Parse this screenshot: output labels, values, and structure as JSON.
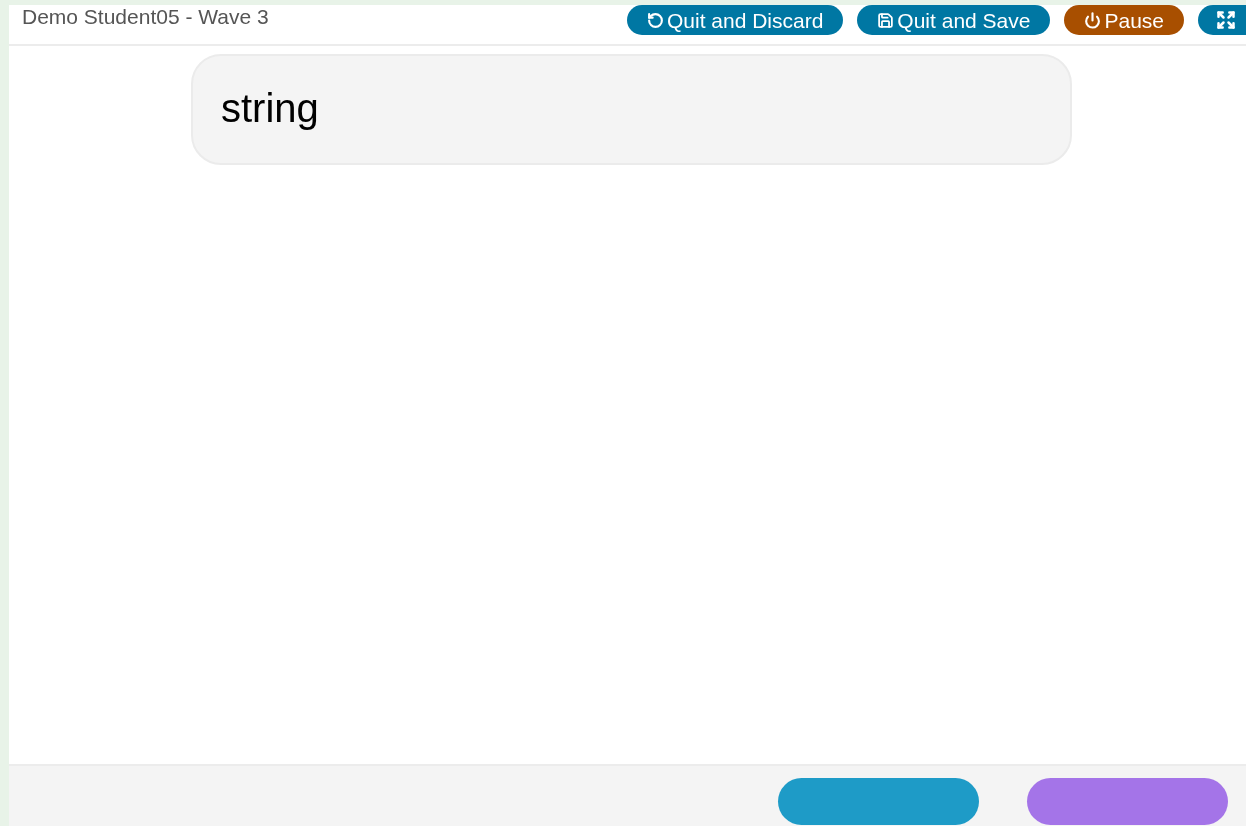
{
  "header": {
    "title": "Demo Student05 - Wave 3",
    "buttons": [
      {
        "kind": "discard",
        "label": "Quit and Discard",
        "color": "#0077a3"
      },
      {
        "kind": "save",
        "label": "Quit and Save",
        "color": "#0077a3"
      },
      {
        "kind": "power",
        "label": "Pause",
        "color": "#a84f00"
      },
      {
        "kind": "fullscreen",
        "color": "#0077a3"
      }
    ]
  },
  "question": {
    "text": "string"
  },
  "footer": {
    "buttons": [
      {
        "color": "#1e9bc7"
      },
      {
        "color": "#a474e8"
      }
    ]
  }
}
